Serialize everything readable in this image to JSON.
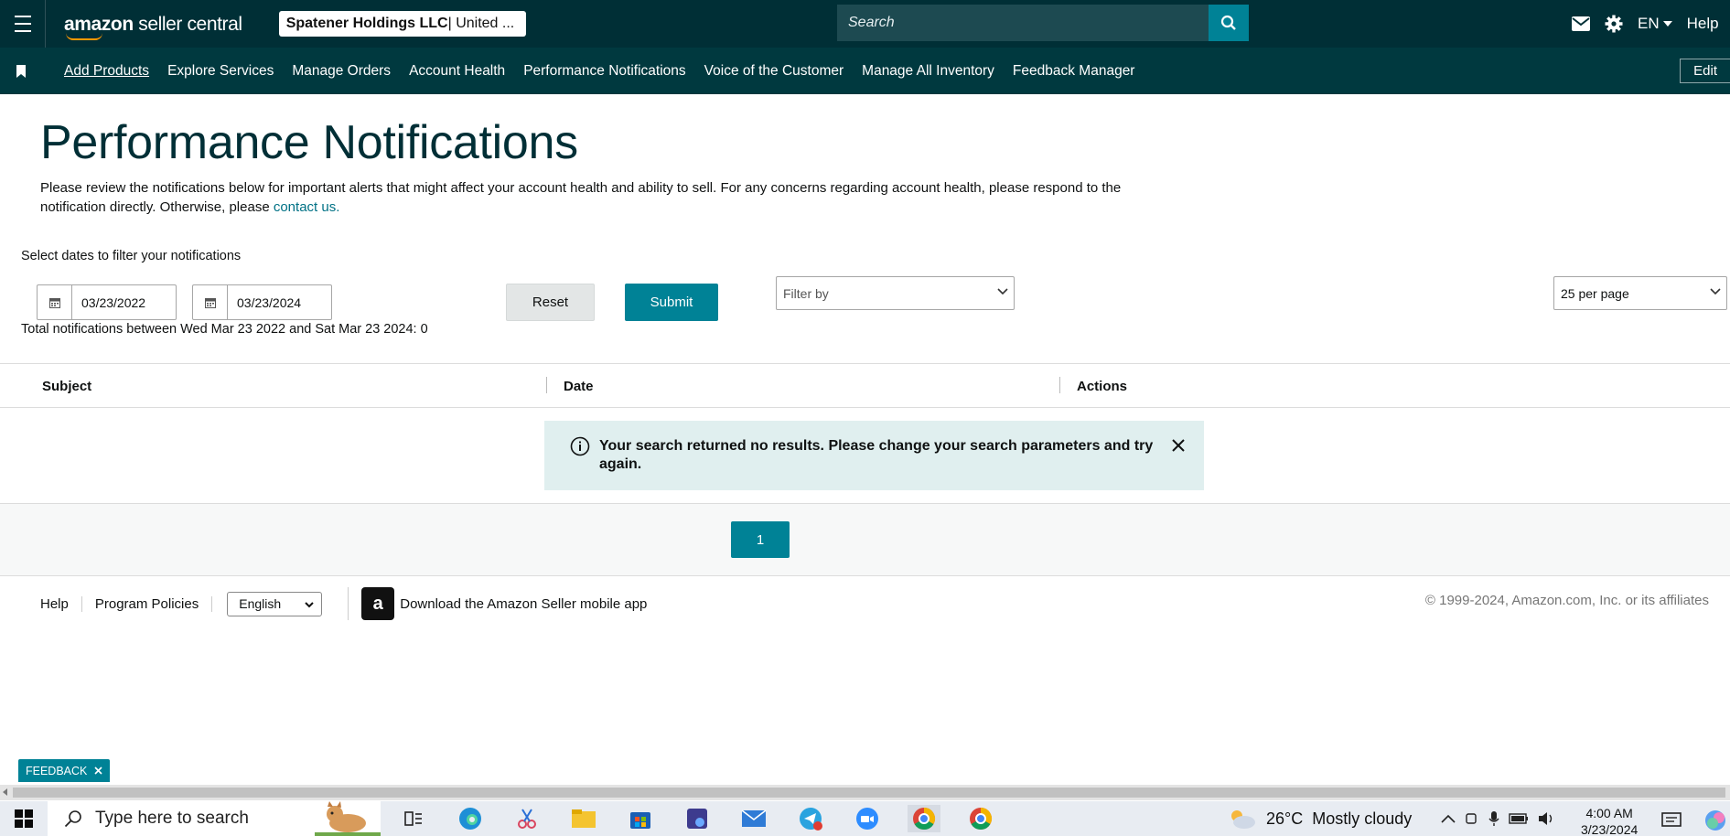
{
  "header": {
    "menu_icon": "hamburger-icon",
    "logo_brand": "amazon",
    "logo_rest": " seller central",
    "account_bold": "Spatener Holdings LLC",
    "account_rest": " | United ...",
    "search_placeholder": "Search",
    "search_icon": "search-icon",
    "language": "EN",
    "help": "Help"
  },
  "nav": {
    "items": [
      {
        "label": "Add Products"
      },
      {
        "label": "Explore Services"
      },
      {
        "label": "Manage Orders"
      },
      {
        "label": "Account Health"
      },
      {
        "label": "Performance Notifications"
      },
      {
        "label": "Voice of the Customer"
      },
      {
        "label": "Manage All Inventory"
      },
      {
        "label": "Feedback Manager"
      }
    ],
    "edit": "Edit"
  },
  "page": {
    "title": "Performance Notifications",
    "description_part1": "Please review the notifications below for important alerts that might affect your account health and ability to sell. For any concerns regarding account health, please respond to the notification directly. Otherwise, please ",
    "description_link": "contact us.",
    "filter_label": "Select dates to filter your notifications",
    "start_date": "03/23/2022",
    "end_date": "03/23/2024",
    "total_text": "Total notifications between Wed Mar 23 2022 and Sat Mar 23 2024: 0",
    "reset": "Reset",
    "submit": "Submit",
    "filter_by": "Filter by",
    "per_page": "25 per page"
  },
  "table": {
    "columns": [
      "Subject",
      "Date",
      "Actions"
    ],
    "empty_message": "Your search returned no results. Please change your search parameters and try again."
  },
  "pagination": {
    "current_page": "1"
  },
  "footer": {
    "help": "Help",
    "policies": "Program Policies",
    "language": "English",
    "app_text": "Download the Amazon Seller mobile app",
    "copyright": "© 1999-2024, Amazon.com, Inc. or its affiliates"
  },
  "feedback_tab": "FEEDBACK",
  "taskbar": {
    "search_placeholder": "Type here to search",
    "weather_temp": "26°C",
    "weather_text": "Mostly cloudy",
    "time": "4:00 AM",
    "date": "3/23/2024"
  },
  "colors": {
    "header_bg": "#002f36",
    "nav_bg": "#00393f",
    "accent": "#008296",
    "alert_bg": "#e0efef"
  }
}
